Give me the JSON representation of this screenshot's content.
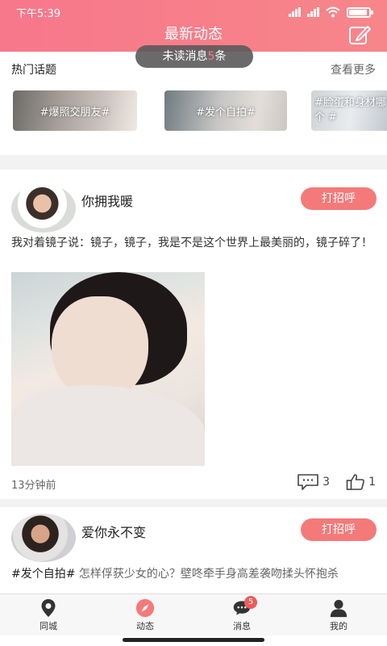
{
  "status_bar": {
    "time": "下午5:39",
    "battery_level": 0.85
  },
  "header": {
    "title": "最新动态",
    "compose_icon": "edit-icon"
  },
  "unread": {
    "prefix": "未读消息",
    "count": "5",
    "suffix": "条"
  },
  "topics": {
    "title": "热门话题",
    "more": "查看更多",
    "items": [
      {
        "label": "#爆照交朋友#"
      },
      {
        "label": "#发个自拍#"
      },
      {
        "label": "#脸蛋和身材哪个 #"
      }
    ]
  },
  "posts": [
    {
      "username": "你拥我暖",
      "greet_label": "打招呼",
      "text": "我对着镜子说：镜子，镜子，我是不是这个世界上最美丽的，镜子碎了！",
      "time": "13分钟前",
      "comments": "3",
      "likes": "1"
    },
    {
      "username": "爱你永不变",
      "greet_label": "打招呼",
      "hashtag": "#发个自拍#",
      "text": " 怎样俘获少女的心？壁咚牵手身高差袭吻揉头怀抱杀"
    }
  ],
  "tabbar": {
    "items": [
      {
        "label": "同城",
        "icon": "location-pin-icon"
      },
      {
        "label": "动态",
        "icon": "compass-icon",
        "active": true
      },
      {
        "label": "消息",
        "icon": "chat-bubble-icon",
        "badge": "5"
      },
      {
        "label": "我的",
        "icon": "person-icon"
      }
    ]
  },
  "colors": {
    "accent": "#f7778b",
    "button": "#f47a7a",
    "badge": "#f05b5b"
  }
}
